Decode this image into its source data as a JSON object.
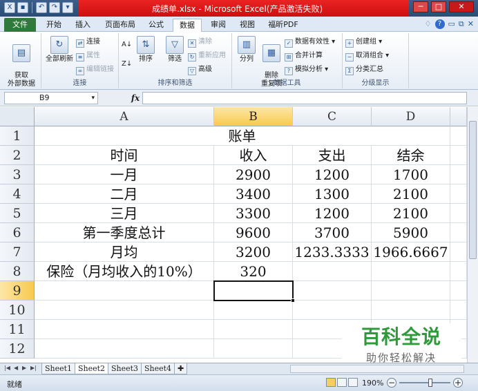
{
  "window": {
    "title": "成绩单.xlsx - Microsoft Excel(产品激活失败)",
    "min": "─",
    "max": "□",
    "close": "✕"
  },
  "tabs": {
    "file": "文件",
    "items": [
      "开始",
      "插入",
      "页面布局",
      "公式",
      "数据",
      "审阅",
      "视图",
      "福昕PDF"
    ],
    "active": "数据"
  },
  "ribbon": {
    "get_data": "获取\n外部数据",
    "connections": {
      "refresh_all": "全部刷新",
      "connect": "连接",
      "properties": "属性",
      "edit_links": "编辑链接",
      "label": "连接"
    },
    "sort_filter": {
      "sort": "排序",
      "filter": "筛选",
      "clear": "清除",
      "reapply": "重新应用",
      "advanced": "高级",
      "label": "排序和筛选"
    },
    "data_tools": {
      "split": "分列",
      "remove_dup": "删除\n重复项",
      "validation": "数据有效性",
      "consolidate": "合并计算",
      "what_if": "模拟分析",
      "label": "数据工具"
    },
    "outline": {
      "group": "创建组",
      "ungroup": "取消组合",
      "subtotal": "分类汇总",
      "label": "分级显示"
    }
  },
  "formula_bar": {
    "name_box": "B9",
    "fx": "fx",
    "value": ""
  },
  "columns": [
    "A",
    "B",
    "C",
    "D"
  ],
  "rows": [
    "1",
    "2",
    "3",
    "4",
    "5",
    "6",
    "7",
    "8",
    "9",
    "10",
    "11",
    "12"
  ],
  "cells": {
    "title": "账单",
    "r2": [
      "时间",
      "收入",
      "支出",
      "结余"
    ],
    "r3": [
      "一月",
      "2900",
      "1200",
      "1700"
    ],
    "r4": [
      "二月",
      "3400",
      "1300",
      "2100"
    ],
    "r5": [
      "三月",
      "3300",
      "1200",
      "2100"
    ],
    "r6": [
      "第一季度总计",
      "9600",
      "3700",
      "5900"
    ],
    "r7": [
      "月均",
      "3200",
      "1233.3333",
      "1966.6667"
    ],
    "r8": [
      "保险（月均收入的10%）",
      "320",
      "",
      ""
    ]
  },
  "sheets": [
    "Sheet1",
    "Sheet2",
    "Sheet3",
    "Sheet4"
  ],
  "active_sheet": "Sheet2",
  "status": {
    "text": "就绪",
    "zoom": "190%"
  },
  "watermark": {
    "title": "百科全说",
    "subtitle": "助你轻松解决"
  }
}
